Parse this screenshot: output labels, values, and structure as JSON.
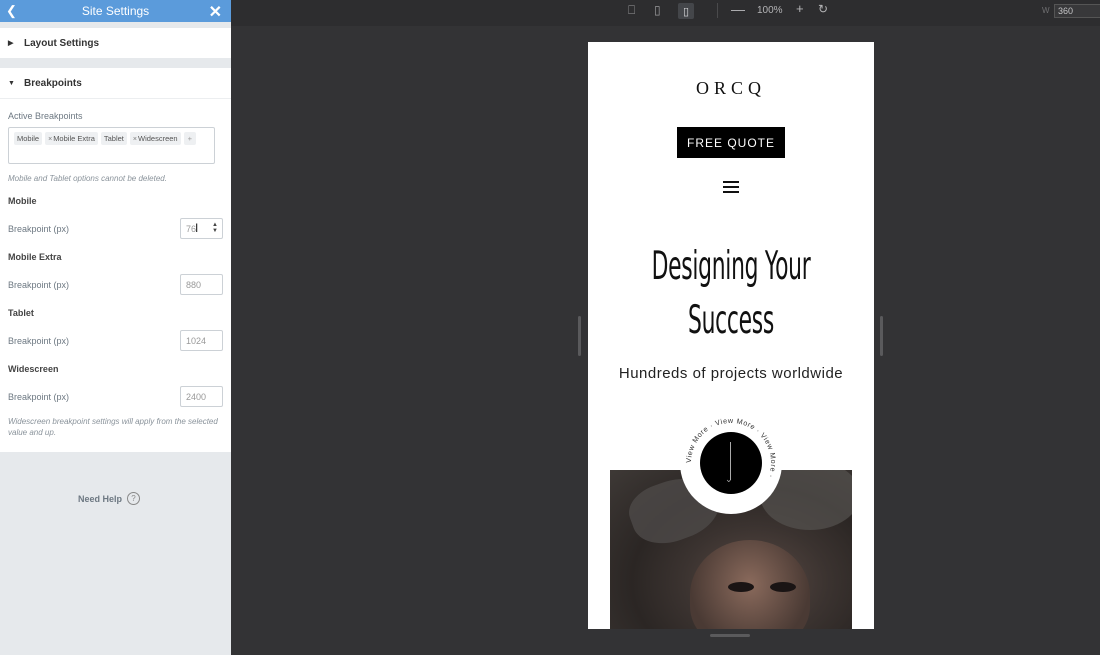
{
  "panel": {
    "title": "Site Settings",
    "sections": {
      "layout": "Layout Settings",
      "breakpoints": "Breakpoints"
    },
    "active_label": "Active Breakpoints",
    "tags": [
      "Mobile",
      "Mobile Extra",
      "Tablet",
      "Widescreen"
    ],
    "tag_add": "+",
    "mobile_note": "Mobile and Tablet options cannot be deleted.",
    "groups": [
      {
        "name": "Mobile",
        "label": "Breakpoint (px)",
        "value": "76"
      },
      {
        "name": "Mobile Extra",
        "label": "Breakpoint (px)",
        "value": "880"
      },
      {
        "name": "Tablet",
        "label": "Breakpoint (px)",
        "value": "1024"
      },
      {
        "name": "Widescreen",
        "label": "Breakpoint (px)",
        "value": "2400"
      }
    ],
    "widescreen_note": "Widescreen breakpoint settings will apply from the selected value and up.",
    "help": "Need Help",
    "help_icon": "?"
  },
  "toolbar": {
    "zoom": "100%",
    "width_label": "W",
    "width_value": "360",
    "icons": [
      "desktop-icon",
      "tablet-icon",
      "mobile-icon",
      "zoom-out-icon",
      "zoom-in-icon",
      "reset-icon"
    ]
  },
  "site": {
    "logo": "ORCQ",
    "cta": "FREE QUOTE",
    "hero_line1": "Designing Your",
    "hero_line2": "Success",
    "subtitle": "Hundreds of projects worldwide",
    "badge_text": "View More · View More · View More ·"
  },
  "colors": {
    "panel_header": "#5b9bdb",
    "canvas_bg": "#333335",
    "cta_bg": "#000000"
  }
}
